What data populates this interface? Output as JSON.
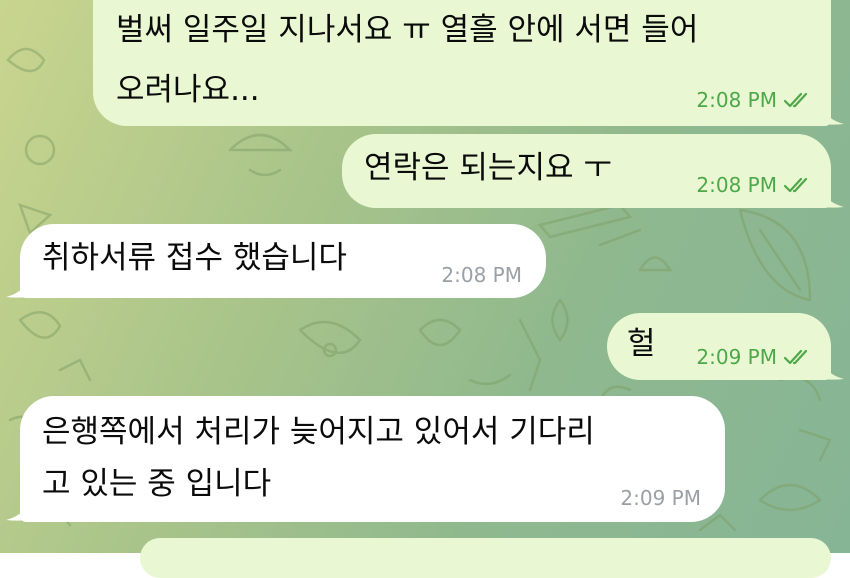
{
  "conversation": {
    "messages": [
      {
        "direction": "outgoing",
        "lines": [
          "벌써 일주일 지나서요 ㅠ 열흘 안에 서면 들어",
          "오려나요..."
        ],
        "time": "2:08 PM",
        "status_icon": "double-check-icon"
      },
      {
        "direction": "outgoing",
        "lines": [
          "연락은 되는지요 ㅜ"
        ],
        "time": "2:08 PM",
        "status_icon": "double-check-icon"
      },
      {
        "direction": "incoming",
        "lines": [
          "취하서류 접수 했습니다"
        ],
        "time": "2:08 PM"
      },
      {
        "direction": "outgoing",
        "lines": [
          "헐"
        ],
        "time": "2:09 PM",
        "status_icon": "double-check-icon"
      },
      {
        "direction": "incoming",
        "lines": [
          "은행쪽에서 처리가 늦어지고 있어서 기다리",
          "고 있는 중 입니다"
        ],
        "time": "2:09 PM"
      }
    ]
  },
  "colors": {
    "outgoing_bubble": "#e9f8d2",
    "incoming_bubble": "#ffffff",
    "outgoing_meta": "#4ea749",
    "incoming_meta": "#9aa0a6",
    "wallpaper": "#a9c48a"
  }
}
